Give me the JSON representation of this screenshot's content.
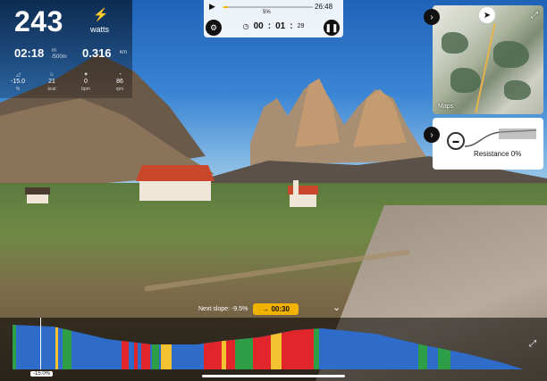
{
  "stats": {
    "power": "243",
    "power_unit": "watts",
    "pace": "02:18",
    "pace_unit": "/500m",
    "pace_prefix": "m",
    "distance": "0.316",
    "distance_unit": "km",
    "metrics": [
      {
        "value": "-15.0",
        "label": "%"
      },
      {
        "value": "21",
        "label": "kcal"
      },
      {
        "value": "0",
        "label": "bpm"
      },
      {
        "value": "86",
        "label": "rpm"
      }
    ]
  },
  "video": {
    "progress_pct": "5%",
    "progress_fraction": 0.05,
    "total_time": "26:48",
    "timer_h": "00",
    "timer_m": "01",
    "timer_s": "29"
  },
  "map": {
    "attribution": "Maps"
  },
  "resistance": {
    "label": "Resistance 0%"
  },
  "next_slope": {
    "label": "Next slope: -9.5%",
    "countdown": "→  00:30"
  },
  "profile": {
    "current_slope": "-15.0%"
  },
  "colors": {
    "accent": "#f2b200",
    "profile_blue": "#2f6bc9",
    "red": "#e0262a",
    "green": "#2e9e46",
    "yellow": "#f2c230"
  }
}
